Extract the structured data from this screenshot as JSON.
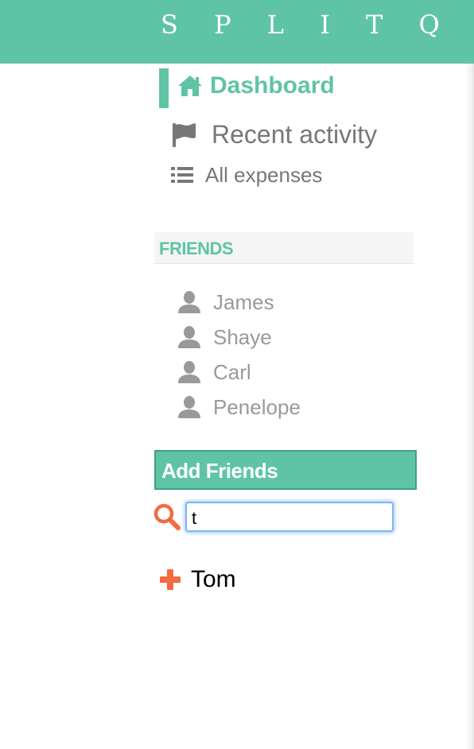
{
  "app": {
    "brand": "S P L I T Q U I C K"
  },
  "nav": {
    "items": [
      {
        "label": "Dashboard",
        "icon": "home-icon",
        "active": true
      },
      {
        "label": "Recent activity",
        "icon": "flag-icon",
        "active": false
      },
      {
        "label": "All expenses",
        "icon": "list-icon",
        "active": false
      }
    ]
  },
  "friends": {
    "header": "FRIENDS",
    "list": [
      {
        "name": "James",
        "icon": "user-icon"
      },
      {
        "name": "Shaye",
        "icon": "user-icon"
      },
      {
        "name": "Carl",
        "icon": "user-icon"
      },
      {
        "name": "Penelope",
        "icon": "user-icon"
      }
    ]
  },
  "add_friends": {
    "header": "Add Friends",
    "search": {
      "value": "t",
      "icon": "search-icon"
    },
    "results": [
      {
        "name": "Tom",
        "icon": "plus-icon"
      }
    ]
  },
  "colors": {
    "accent": "#5fc4a6",
    "accent_border": "#3fa082",
    "nav_text": "#777777",
    "friend_text": "#999999",
    "action_orange": "#f36b3f"
  }
}
